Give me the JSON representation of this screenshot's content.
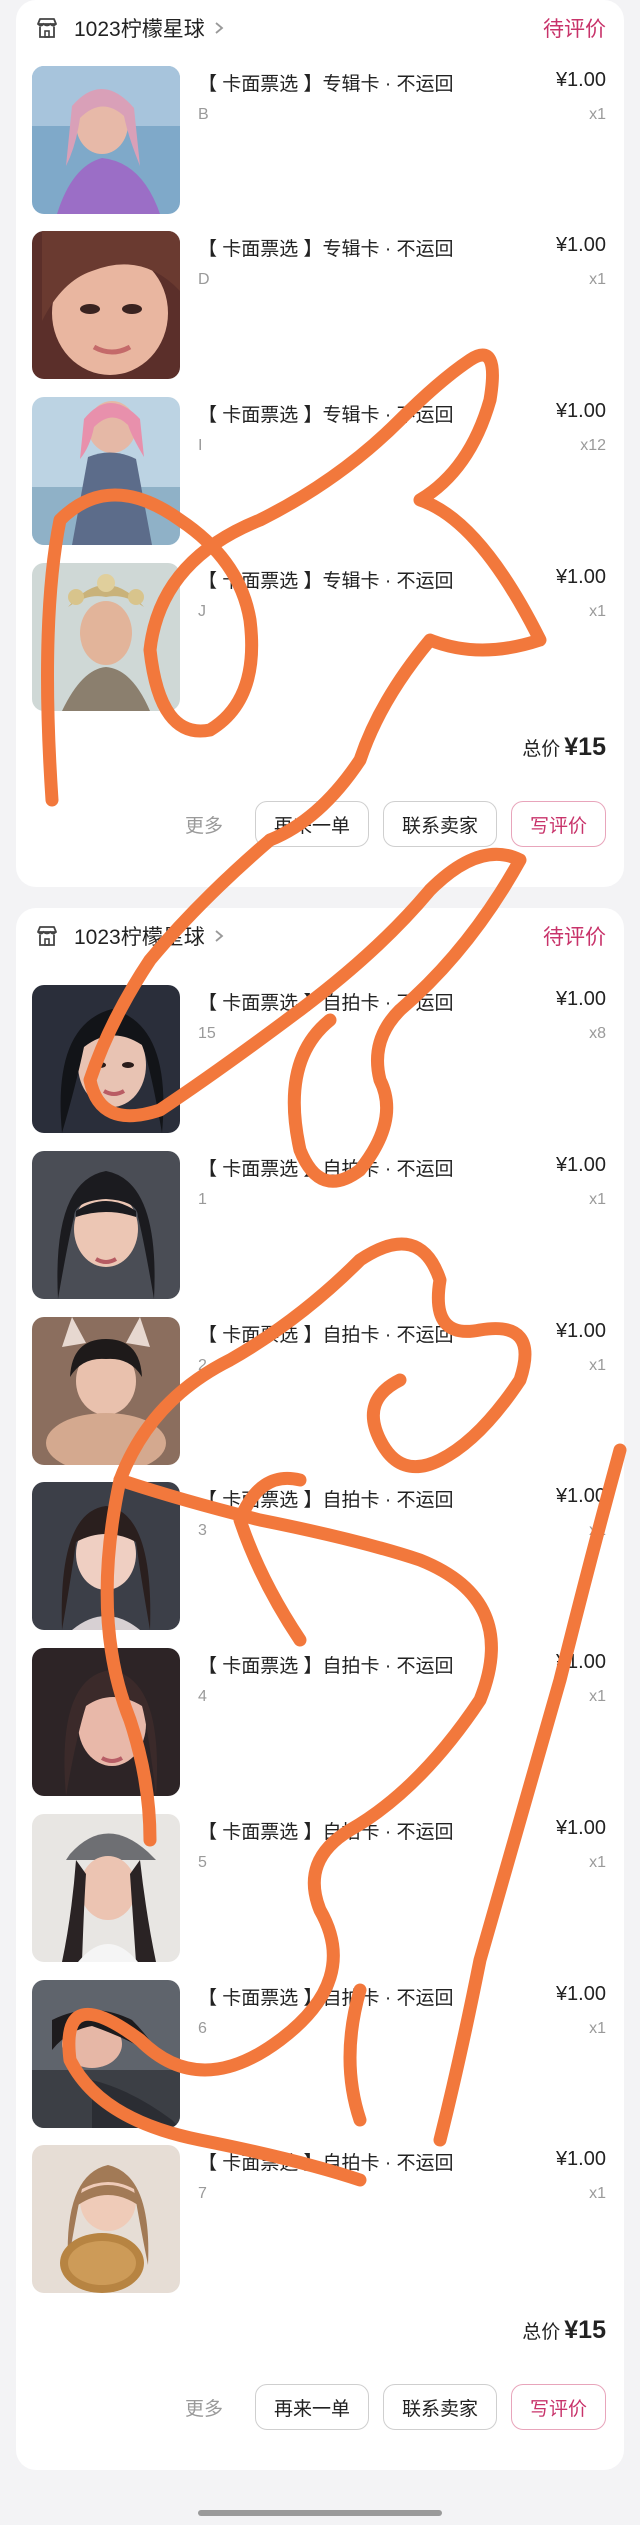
{
  "orders": [
    {
      "store_name": "1023柠檬星球",
      "status": "待评价",
      "items": [
        {
          "title": "【 卡面票选 】专辑卡 · 不运回",
          "spec": "B",
          "price": "¥1.00",
          "qty": "x1",
          "photo": "woman-purple-dress-photo"
        },
        {
          "title": "【 卡面票选 】专辑卡 · 不运回",
          "spec": "D",
          "price": "¥1.00",
          "qty": "x1",
          "photo": "closeup-face-photo"
        },
        {
          "title": "【 卡面票选 】专辑卡 · 不运回",
          "spec": "I",
          "price": "¥1.00",
          "qty": "x12",
          "photo": "pink-hair-stage-photo"
        },
        {
          "title": "【 卡面票选 】专辑卡 · 不运回",
          "spec": "J",
          "price": "¥1.00",
          "qty": "x1",
          "photo": "floral-headpiece-photo"
        }
      ],
      "total_label": "总价",
      "total_amount": "¥15",
      "more_label": "更多",
      "buttons": {
        "reorder": "再来一单",
        "contact": "联系卖家",
        "review": "写评价"
      }
    },
    {
      "store_name": "1023柠檬星球",
      "status": "待评价",
      "items": [
        {
          "title": "【 卡面票选 】自拍卡 · 不运回",
          "spec": "15",
          "price": "¥1.00",
          "qty": "x8",
          "photo": "dark-hair-selfie-photo"
        },
        {
          "title": "【 卡面票选 】自拍卡 · 不运回",
          "spec": "1",
          "price": "¥1.00",
          "qty": "x1",
          "photo": "bangs-selfie-photo"
        },
        {
          "title": "【 卡面票选 】自拍卡 · 不运回",
          "spec": "2",
          "price": "¥1.00",
          "qty": "x1",
          "photo": "bunny-ears-selfie-photo"
        },
        {
          "title": "【 卡面票选 】自拍卡 · 不运回",
          "spec": "3",
          "price": "¥1.00",
          "qty": "x1",
          "photo": "long-hair-selfie-photo"
        },
        {
          "title": "【 卡面票选 】自拍卡 · 不运回",
          "spec": "4",
          "price": "¥1.00",
          "qty": "x1",
          "photo": "soft-light-selfie-photo"
        },
        {
          "title": "【 卡面票选 】自拍卡 · 不运回",
          "spec": "5",
          "price": "¥1.00",
          "qty": "x1",
          "photo": "cap-selfie-photo"
        },
        {
          "title": "【 卡面票选 】自拍卡 · 不运回",
          "spec": "6",
          "price": "¥1.00",
          "qty": "x1",
          "photo": "lying-down-selfie-photo"
        },
        {
          "title": "【 卡面票选 】自拍卡 · 不运回",
          "spec": "7",
          "price": "¥1.00",
          "qty": "x1",
          "photo": "bread-selfie-photo"
        }
      ],
      "total_label": "总价",
      "total_amount": "¥15",
      "more_label": "更多",
      "buttons": {
        "reorder": "再来一单",
        "contact": "联系卖家",
        "review": "写评价"
      }
    }
  ],
  "colors": {
    "accent": "#c8336a",
    "scribble": "#f2783c",
    "background": "#f3f3f5"
  },
  "icons": {
    "store": "store-icon",
    "chevron": "chevron-right-icon"
  }
}
